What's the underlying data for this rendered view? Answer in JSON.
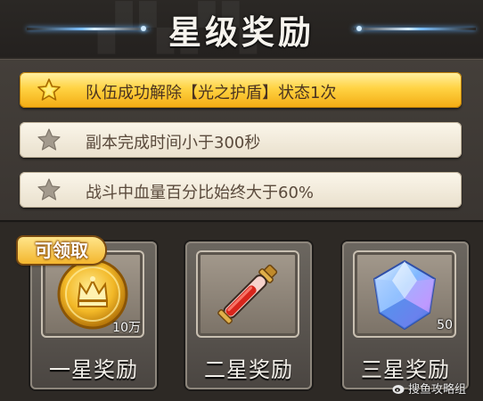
{
  "header": {
    "title": "星级奖励"
  },
  "conditions": [
    {
      "text": "队伍成功解除【光之护盾】状态1次",
      "achieved": true
    },
    {
      "text": "副本完成时间小于300秒",
      "achieved": false
    },
    {
      "text": "战斗中血量百分比始终大于60%",
      "achieved": false
    }
  ],
  "rewards": [
    {
      "label": "一星奖励",
      "item_icon": "gold-coin-icon",
      "qty": "10万",
      "claimable": true
    },
    {
      "label": "二星奖励",
      "item_icon": "red-potion-vial-icon",
      "qty": "",
      "claimable": false
    },
    {
      "label": "三星奖励",
      "item_icon": "blue-diamond-icon",
      "qty": "50",
      "claimable": false
    }
  ],
  "claim_badge": "可领取",
  "watermark": "搜鱼攻略组",
  "colors": {
    "active_row": "#ffd343",
    "inactive_row": "#f3ecdc",
    "badge": "#f3b62e",
    "background": "#2a2623"
  }
}
